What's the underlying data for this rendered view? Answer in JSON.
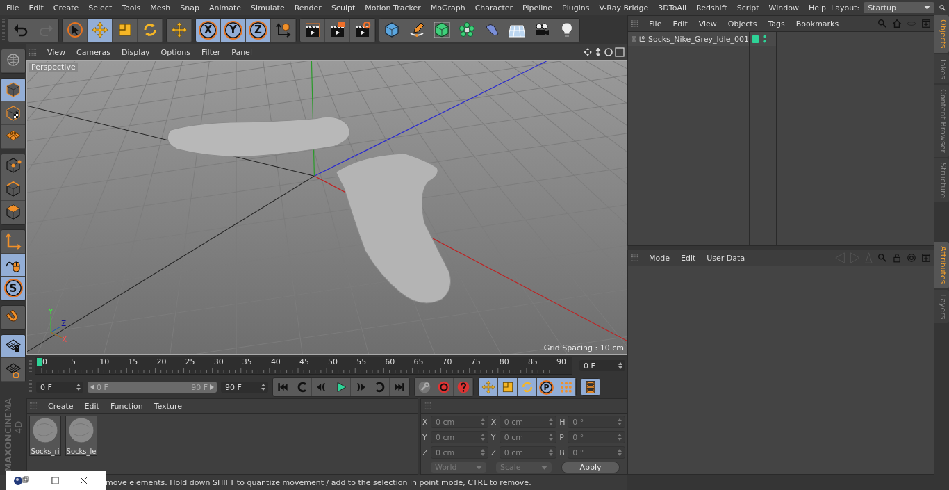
{
  "menu": [
    "File",
    "Edit",
    "Create",
    "Select",
    "Tools",
    "Mesh",
    "Snap",
    "Animate",
    "Simulate",
    "Render",
    "Sculpt",
    "Motion Tracker",
    "MoGraph",
    "Character",
    "Pipeline",
    "Plugins",
    "V-Ray Bridge",
    "3DToAll",
    "Redshift",
    "Script",
    "Window",
    "Help"
  ],
  "layout": {
    "label": "Layout:",
    "value": "Startup"
  },
  "toolbar": [
    {
      "buttons": [
        {
          "kind": "undo",
          "selected": false
        },
        {
          "kind": "redo",
          "selected": false
        }
      ]
    },
    {
      "buttons": [
        {
          "kind": "select",
          "selected": false
        },
        {
          "kind": "move",
          "selected": true
        },
        {
          "kind": "scale",
          "selected": false
        },
        {
          "kind": "rotate",
          "selected": false
        }
      ]
    },
    {
      "buttons": [
        {
          "kind": "move",
          "selected": false
        }
      ]
    },
    {
      "buttons": [
        {
          "kind": "letter",
          "label": "X",
          "selected": true
        },
        {
          "kind": "letter",
          "label": "Y",
          "selected": true
        },
        {
          "kind": "letter",
          "label": "Z",
          "selected": true
        },
        {
          "kind": "coord",
          "selected": false
        }
      ]
    },
    {
      "buttons": [
        {
          "kind": "render",
          "selected": false
        },
        {
          "kind": "render-pic",
          "selected": false
        },
        {
          "kind": "render-settings",
          "selected": false
        }
      ]
    },
    {
      "buttons": [
        {
          "kind": "cube",
          "selected": false
        },
        {
          "kind": "pen",
          "selected": false
        },
        {
          "kind": "subdiv",
          "selected": false
        },
        {
          "kind": "cloner",
          "selected": false
        },
        {
          "kind": "deformer",
          "selected": false
        },
        {
          "kind": "floor",
          "selected": false
        },
        {
          "kind": "camera",
          "selected": false
        },
        {
          "kind": "light",
          "selected": false
        }
      ]
    }
  ],
  "left_tools": [
    {
      "buttons": [
        {
          "kind": "globe",
          "selected": false
        }
      ]
    },
    {
      "buttons": [
        {
          "kind": "model",
          "selected": true
        },
        {
          "kind": "texture",
          "selected": false
        },
        {
          "kind": "workplane",
          "selected": false
        }
      ]
    },
    {
      "buttons": [
        {
          "kind": "points",
          "selected": false
        },
        {
          "kind": "edges",
          "selected": false
        },
        {
          "kind": "polygons",
          "selected": false
        }
      ]
    },
    {
      "buttons": [
        {
          "kind": "axis",
          "selected": false
        },
        {
          "kind": "tweak",
          "selected": true
        },
        {
          "kind": "letter",
          "label": "S",
          "selected": true
        }
      ]
    },
    {
      "buttons": [
        {
          "kind": "magnet",
          "selected": false
        }
      ]
    },
    {
      "buttons": [
        {
          "kind": "lock-grid",
          "selected": true
        },
        {
          "kind": "anim-grid",
          "selected": false
        }
      ]
    }
  ],
  "logo": [
    "MAXON",
    "CINEMA 4D"
  ],
  "viewport": {
    "menu": [
      "View",
      "Cameras",
      "Display",
      "Options",
      "Filter",
      "Panel"
    ],
    "camera": "Perspective",
    "grid_spacing": "Grid Spacing : 10 cm",
    "axis_labels": [
      "Y",
      "Z",
      "X"
    ]
  },
  "objects_panel": {
    "menu": [
      "File",
      "Edit",
      "View",
      "Objects",
      "Tags",
      "Bookmarks"
    ],
    "objects": [
      {
        "name": "Socks_Nike_Grey_Idle_001",
        "expanded": false
      }
    ]
  },
  "attributes_panel": {
    "menu": [
      "Mode",
      "Edit",
      "User Data"
    ]
  },
  "side_tabs_top": [
    {
      "label": "Objects",
      "selected": true
    },
    {
      "label": "Takes",
      "selected": false
    },
    {
      "label": "Content Browser",
      "selected": false
    },
    {
      "label": "Structure",
      "selected": false
    }
  ],
  "side_tabs_bottom": [
    {
      "label": "Attributes",
      "selected": true
    },
    {
      "label": "Layers",
      "selected": false
    }
  ],
  "timeline": {
    "ticks": [
      "0",
      "5",
      "10",
      "15",
      "20",
      "25",
      "30",
      "35",
      "40",
      "45",
      "50",
      "55",
      "60",
      "65",
      "70",
      "75",
      "80",
      "85",
      "90"
    ],
    "playhead": {
      "level": 0
    },
    "current": "0 F"
  },
  "controls": {
    "start": "0 F",
    "range": {
      "level": 1
    },
    "range_start": "0 F",
    "range_end": "90 F",
    "end": "90 F",
    "transport": [
      {
        "kind": "first"
      },
      {
        "kind": "prev-key"
      },
      {
        "kind": "prev-frame"
      },
      {
        "kind": "play"
      },
      {
        "kind": "next-frame"
      },
      {
        "kind": "next-key"
      },
      {
        "kind": "last"
      }
    ],
    "keys": [
      {
        "kind": "keyframe-off",
        "selected": false
      },
      {
        "kind": "record",
        "selected": false
      },
      {
        "kind": "help",
        "selected": false
      }
    ],
    "tracks": [
      {
        "kind": "move",
        "selected": true
      },
      {
        "kind": "scale",
        "selected": true
      },
      {
        "kind": "rotate",
        "selected": true
      },
      {
        "kind": "letter",
        "label": "P",
        "selected": true
      },
      {
        "kind": "dots",
        "selected": true
      }
    ],
    "timeline_button": {
      "kind": "film",
      "selected": true
    }
  },
  "materials": {
    "menu": [
      "Create",
      "Edit",
      "Function",
      "Texture"
    ],
    "items": [
      {
        "name": "Socks_ri"
      },
      {
        "name": "Socks_le"
      }
    ]
  },
  "coordinates": {
    "headers": [
      "--",
      "--",
      "--"
    ],
    "columns": [
      [
        {
          "axis": "X",
          "value": "0 cm"
        },
        {
          "axis": "Y",
          "value": "0 cm"
        },
        {
          "axis": "Z",
          "value": "0 cm"
        }
      ],
      [
        {
          "axis": "X",
          "value": "0 cm"
        },
        {
          "axis": "Y",
          "value": "0 cm"
        },
        {
          "axis": "Z",
          "value": "0 cm"
        }
      ],
      [
        {
          "axis": "H",
          "value": "0 °"
        },
        {
          "axis": "P",
          "value": "0 °"
        },
        {
          "axis": "B",
          "value": "0 °"
        }
      ]
    ],
    "disabled": true,
    "dropdowns": [
      {
        "value": "World",
        "disabled": true
      },
      {
        "value": "Scale",
        "disabled": true
      }
    ],
    "apply": "Apply"
  },
  "status": "move elements. Hold down SHIFT to quantize movement / add to the selection in point mode, CTRL to remove."
}
